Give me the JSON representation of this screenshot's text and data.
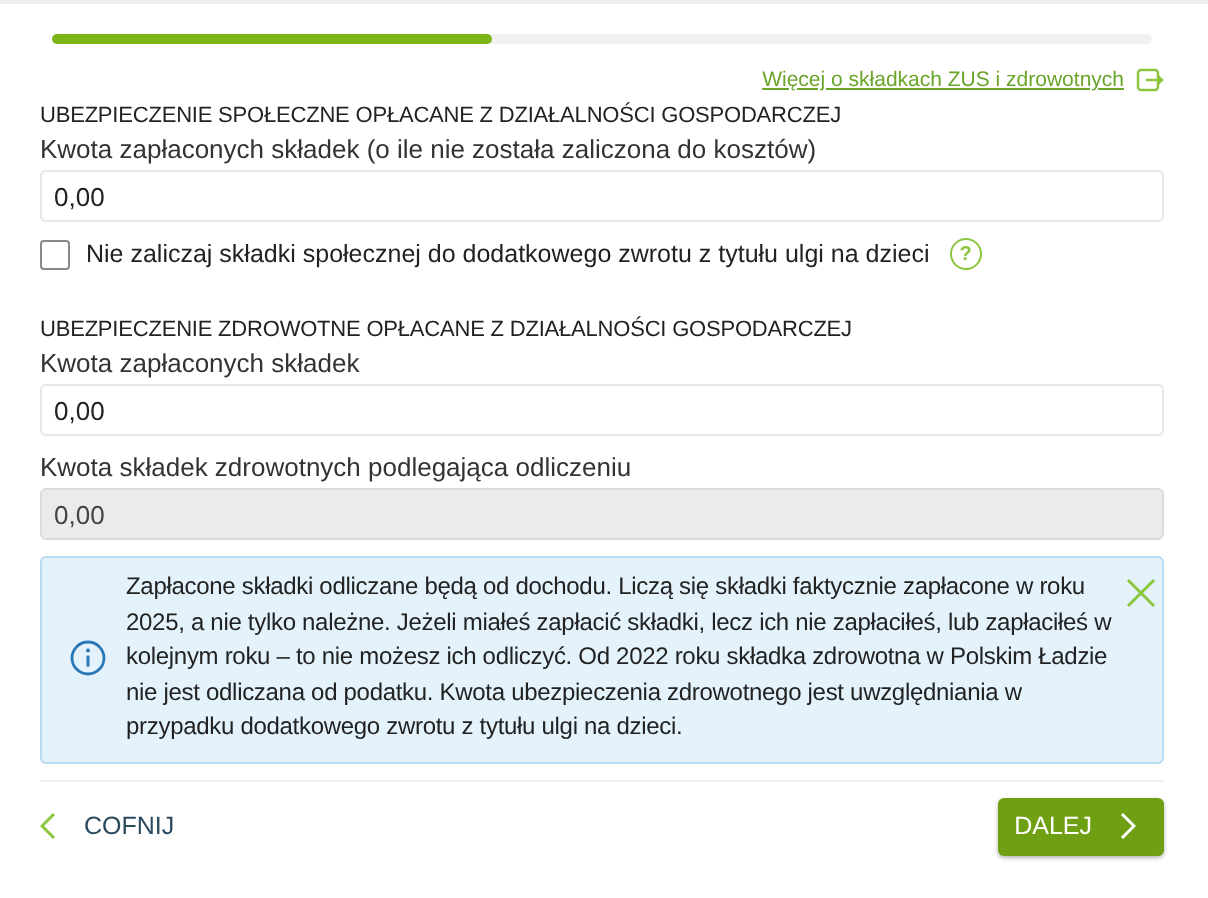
{
  "progress": {
    "level": 0.4
  },
  "link": {
    "text": "Więcej o składkach ZUS i zdrowotnych"
  },
  "sections": [
    {
      "heading": "UBEZPIECZENIE SPOŁECZNE OPŁACANE Z DZIAŁALNOŚCI GOSPODARCZEJ",
      "fields": [
        {
          "kind": "input",
          "label": "Kwota zapłaconych składek (o ile nie została zaliczona do kosztów)",
          "value": "0,00",
          "disabled": false
        },
        {
          "kind": "checkbox",
          "label": "Nie zaliczaj składki społecznej do dodatkowego zwrotu z tytułu ulgi na dzieci",
          "checked": false,
          "help": "?"
        }
      ]
    },
    {
      "heading": "UBEZPIECZENIE ZDROWOTNE OPŁACANE Z DZIAŁALNOŚCI GOSPODARCZEJ",
      "fields": [
        {
          "kind": "input",
          "label": "Kwota zapłaconych składek",
          "value": "0,00",
          "disabled": false
        },
        {
          "kind": "input",
          "label": "Kwota składek zdrowotnych podlegająca odliczeniu",
          "value": "0,00",
          "disabled": true
        }
      ]
    }
  ],
  "info": {
    "text": "Zapłacone składki odliczane będą od dochodu. Liczą się składki faktycznie zapłacone w roku 2025, a nie tylko należne. Jeżeli miałeś zapłacić składki, lecz ich nie zapłaciłeś, lub zapłaciłeś w kolejnym roku – to nie możesz ich odliczyć. Od 2022 roku składka zdrowotna w Polskim Ładzie nie jest odliczana od podatku. Kwota ubezpieczenia zdrowotnego jest uwzględniania w przypadku dodatkowego zwrotu z tytułu ulgi na dzieci.",
    "dismissible": true
  },
  "nav": {
    "back": "COFNIJ",
    "next": "DALEJ"
  }
}
